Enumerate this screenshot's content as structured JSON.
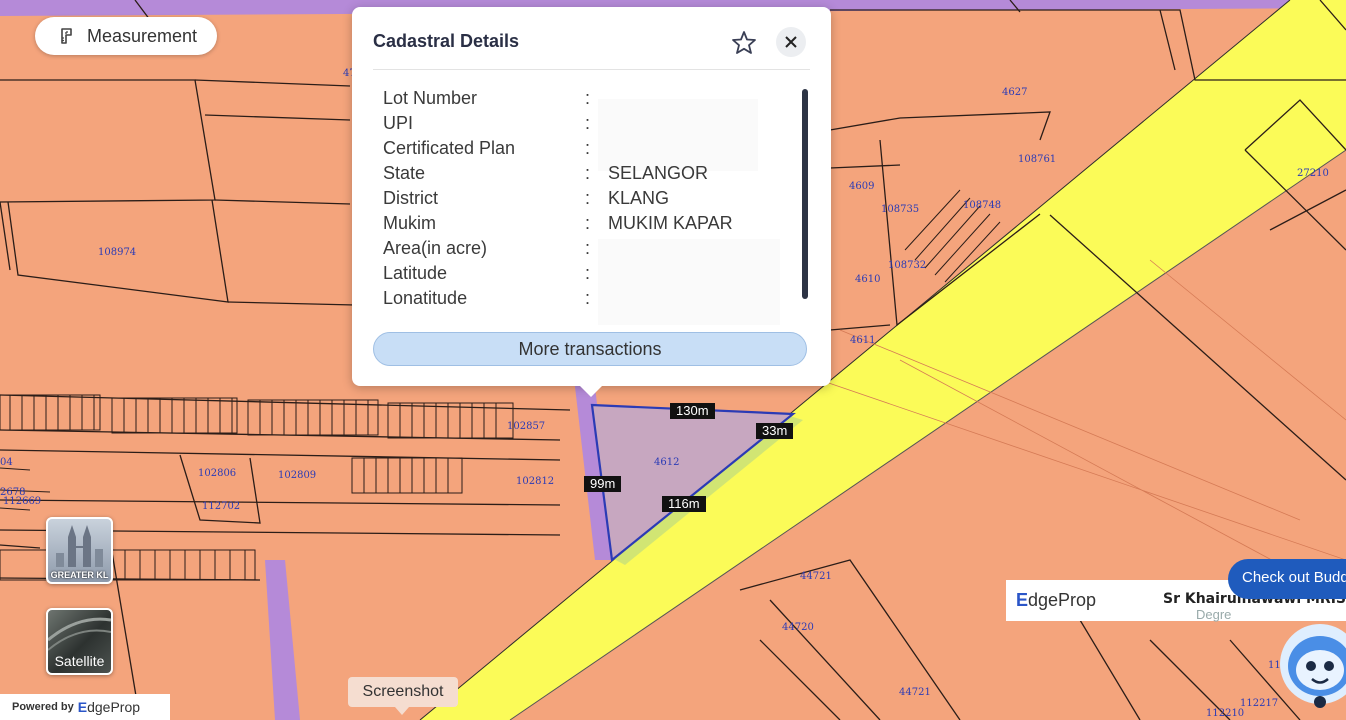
{
  "measurement": {
    "label": "Measurement"
  },
  "popup": {
    "title": "Cadastral Details",
    "fields": [
      {
        "key": "Lot Number",
        "value": ""
      },
      {
        "key": "UPI",
        "value": ""
      },
      {
        "key": "Certificated Plan",
        "value": ""
      },
      {
        "key": "State",
        "value": "SELANGOR"
      },
      {
        "key": "District",
        "value": "KLANG"
      },
      {
        "key": "Mukim",
        "value": "MUKIM KAPAR"
      },
      {
        "key": "Area(in acre)",
        "value": ""
      },
      {
        "key": "Latitude",
        "value": ""
      },
      {
        "key": "Lonatitude",
        "value": ""
      }
    ],
    "separator": ":",
    "more_button": "More transactions"
  },
  "dimensions": {
    "top": "130m",
    "right": "33m",
    "left": "99m",
    "bottom": "116m"
  },
  "lot_labels": {
    "l4627": "4627",
    "l27210": "27210",
    "l108761": "108761",
    "l4609": "4609",
    "l108735": "108735",
    "l108748": "108748",
    "l4610": "4610",
    "l108732": "108732",
    "l4611": "4611",
    "l108974": "108974",
    "l102857": "102857",
    "l102806": "102806",
    "l102809": "102809",
    "l102812": "102812",
    "l112702": "112702",
    "l4612": "4612",
    "l44721a": "44721",
    "l44720": "44720",
    "l44721b": "44721",
    "l112217": "112217",
    "l112210": "112210",
    "l112010": "112010",
    "l04": "04",
    "l2678": "2678",
    "l112669": "112669",
    "l47": "47"
  },
  "layers": {
    "greater_kl": "GREATER KL",
    "satellite": "Satellite"
  },
  "screenshot_button": "Screenshot",
  "powered_by": {
    "prefix": "Powered by",
    "brand_e": "E",
    "brand_rest": "dgeProp"
  },
  "banner": {
    "brand_e": "E",
    "brand_rest": "dgeProp",
    "agent": "Sr Khairulnawawi MRISM",
    "degree": "Degre"
  },
  "chat": {
    "text": "Check out Budd"
  },
  "colors": {
    "land": "#f4a47c",
    "road": "#b58ad8",
    "highway": "#fbfb58",
    "selected_lot": "#c7a7c0",
    "boundary": "#2b3bb5",
    "accent": "#1f5bbd"
  }
}
